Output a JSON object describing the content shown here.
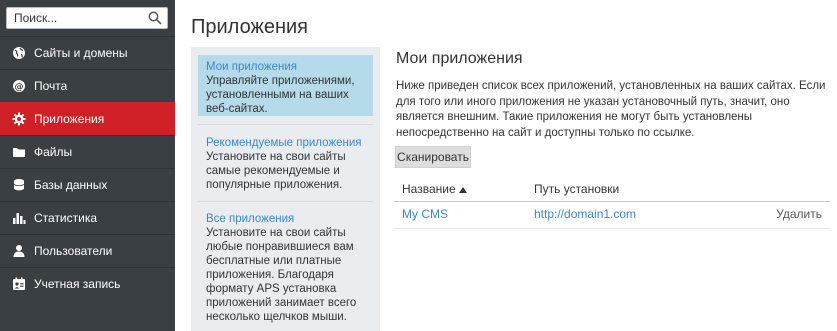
{
  "search": {
    "placeholder": "Поиск..."
  },
  "sidebar": {
    "items": [
      {
        "label": "Сайты и домены",
        "icon": "globe-icon"
      },
      {
        "label": "Почта",
        "icon": "mail-icon"
      },
      {
        "label": "Приложения",
        "icon": "gear-icon",
        "active": true
      },
      {
        "label": "Файлы",
        "icon": "folder-icon"
      },
      {
        "label": "Базы данных",
        "icon": "database-icon"
      },
      {
        "label": "Статистика",
        "icon": "bar-chart-icon"
      },
      {
        "label": "Пользователи",
        "icon": "user-icon"
      },
      {
        "label": "Учетная запись",
        "icon": "account-icon"
      }
    ]
  },
  "page": {
    "title": "Приложения"
  },
  "subnav": {
    "items": [
      {
        "title": "Мои приложения",
        "desc": "Управляйте приложениями, установленными на ваших веб-сайтах."
      },
      {
        "title": "Рекомендуемые приложения",
        "desc": "Установите на свои сайты самые рекомендуемые и популярные приложения."
      },
      {
        "title": "Все приложения",
        "desc": "Установите на свои сайты любые понравившиеся вам бесплатные или платные приложения. Благодаря формату APS установка приложений занимает всего несколько щелчков мыши."
      }
    ]
  },
  "main": {
    "title": "Мои приложения",
    "description": "Ниже приведен список всех приложений, установленных на ваших сайтах. Если для того или иного приложения не указан установочный путь, значит, оно является внешним. Такие приложения не могут быть установлены непосредственно на сайт и доступны только по ссылке.",
    "scan_label": "Сканировать",
    "table": {
      "headers": {
        "name": "Название",
        "path": "Путь установки"
      },
      "rows": [
        {
          "name": "My CMS",
          "path": "http://domain1.com",
          "action": "Удалить"
        }
      ]
    }
  },
  "colors": {
    "sidebar_bg": "#3a3f44",
    "active": "#cf2027",
    "link": "#3d85c6",
    "subnav_selected": "#b5daea"
  }
}
